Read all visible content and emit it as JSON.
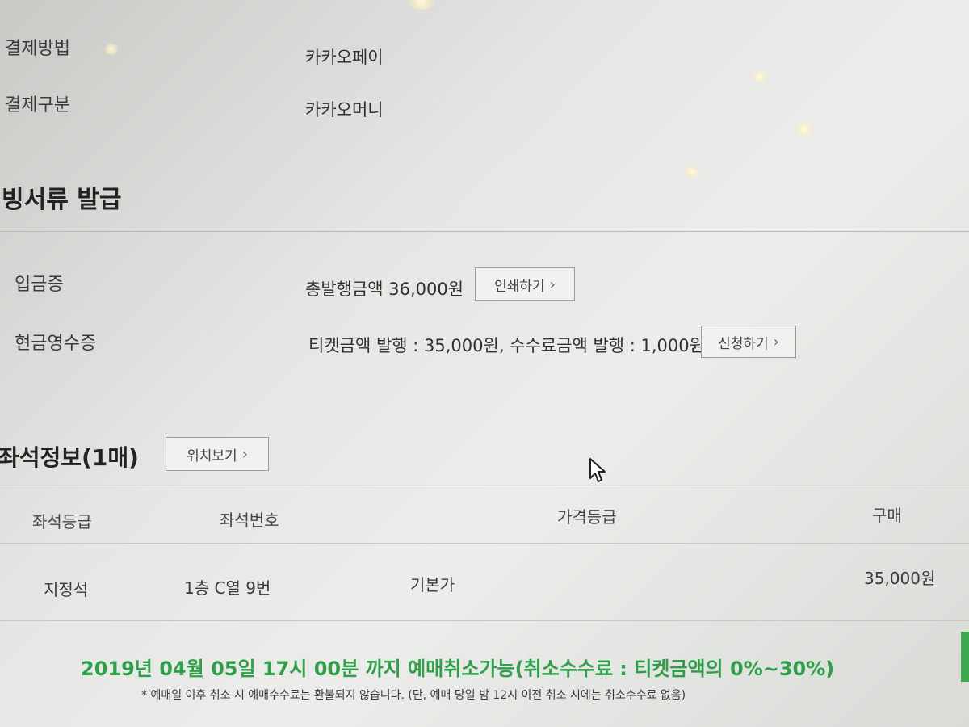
{
  "payment": {
    "method_label": "결제방법",
    "method_value": "카카오페이",
    "type_label": "결제구분",
    "type_value": "카카오머니"
  },
  "documents": {
    "title": "빙서류 발급",
    "deposit_label": "입금증",
    "deposit_value": "총발행금액 36,000원",
    "deposit_button": "인쇄하기",
    "cash_label": "현금영수증",
    "cash_value": "티켓금액 발행 : 35,000원, 수수료금액 발행 : 1,000원",
    "cash_button": "신청하기"
  },
  "seats": {
    "title": "좌석정보(1매)",
    "location_button": "위치보기",
    "columns": [
      "좌석등급",
      "좌석번호",
      "가격등급",
      "구매"
    ],
    "rows": [
      {
        "grade": "지정석",
        "number": "1층 C열 9번",
        "price_grade": "기본가",
        "price": "35,000원"
      }
    ]
  },
  "notice": {
    "cancel_deadline": "2019년 04월 05일 17시 00분 까지 예매취소가능(취소수수료 : 티켓금액의 0%~30%)",
    "footnote": "* 예매일 이후 취소 시 예매수수료는 환불되지 않습니다. (단, 예매 당일 밤 12시 이전 취소 시에는 취소수수료 없음)"
  },
  "icons": {
    "chevron": "chevron-right-icon",
    "cursor": "mouse-pointer-icon"
  },
  "colors": {
    "notice_green": "#2fa04a",
    "background": "#e6e7e4"
  }
}
